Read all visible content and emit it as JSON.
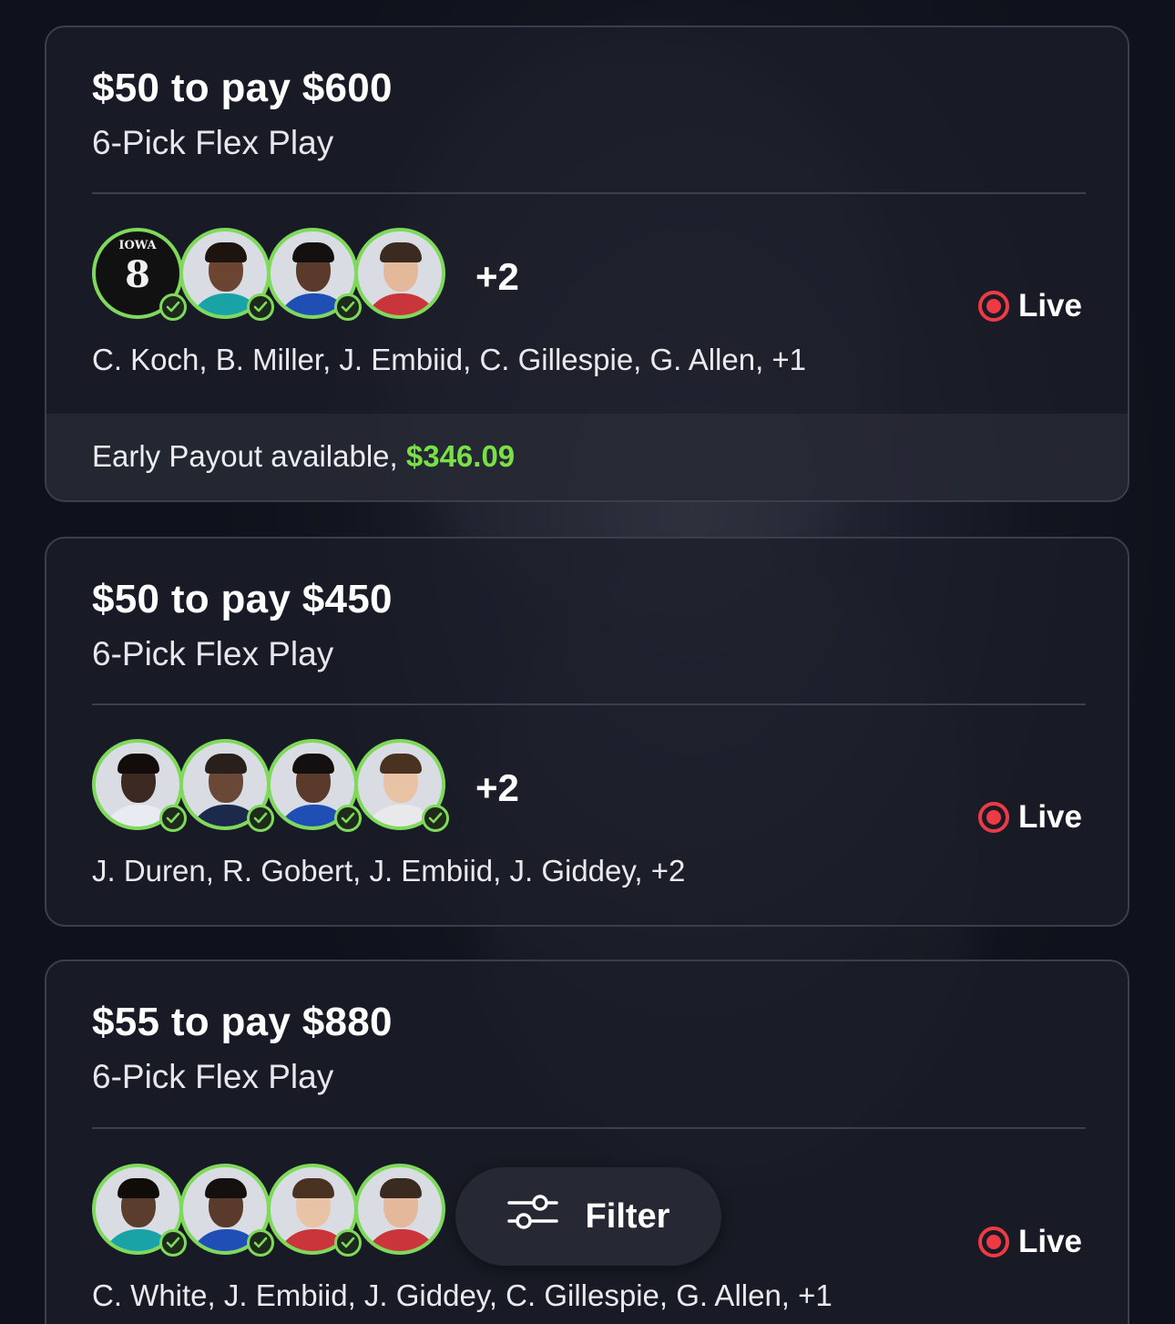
{
  "colors": {
    "accent_green": "#7fd95a",
    "payout_green": "#79e046",
    "live_red": "#ee3a44",
    "background": "#101320"
  },
  "cards": [
    {
      "title": "$50 to pay $600",
      "subtitle": "6-Pick Flex Play",
      "extra_count": "+2",
      "status": "Live",
      "players": "C. Koch, B. Miller, J. Embiid, C. Gillespie, G. Allen, +1",
      "avatars": [
        {
          "label": "IOWA",
          "number": "8",
          "checked": true
        },
        {
          "checked": true
        },
        {
          "checked": true
        },
        {
          "checked": false
        }
      ],
      "payout_label": "Early Payout available,",
      "payout_amount": "$346.09"
    },
    {
      "title": "$50 to pay $450",
      "subtitle": "6-Pick Flex Play",
      "extra_count": "+2",
      "status": "Live",
      "players": "J. Duren, R. Gobert, J. Embiid, J. Giddey, +2",
      "avatars": [
        {
          "checked": true
        },
        {
          "checked": true
        },
        {
          "checked": true
        },
        {
          "checked": true
        }
      ]
    },
    {
      "title": "$55 to pay $880",
      "subtitle": "6-Pick Flex Play",
      "status": "Live",
      "players": "C. White, J. Embiid, J. Giddey, C. Gillespie, G. Allen, +1",
      "avatars": [
        {
          "checked": true
        },
        {
          "checked": true
        },
        {
          "checked": true
        },
        {
          "checked": false
        }
      ]
    }
  ],
  "filter": {
    "label": "Filter",
    "icon": "sliders-icon"
  }
}
